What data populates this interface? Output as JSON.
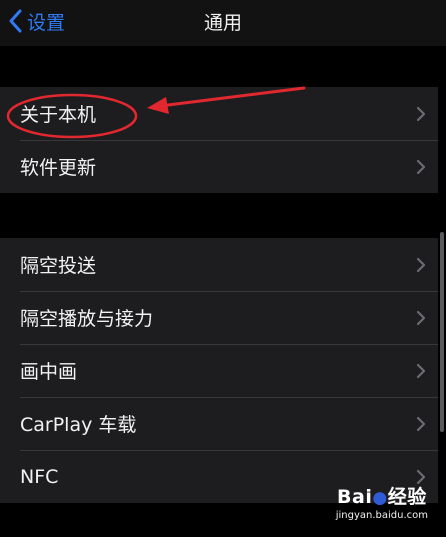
{
  "navbar": {
    "back_label": "设置",
    "title": "通用"
  },
  "group1": {
    "items": [
      {
        "label": "关于本机"
      },
      {
        "label": "软件更新"
      }
    ]
  },
  "group2": {
    "items": [
      {
        "label": "隔空投送"
      },
      {
        "label": "隔空播放与接力"
      },
      {
        "label": "画中画"
      },
      {
        "label": "CarPlay 车载"
      },
      {
        "label": "NFC"
      }
    ]
  },
  "watermark": {
    "logo_text_left": "Bai",
    "logo_text_right": "经验",
    "url": "jingyan.baidu.com"
  },
  "colors": {
    "accent": "#2f7bf6",
    "annotation": "#e0282e",
    "watermark_paw": "#2f5bd6"
  }
}
